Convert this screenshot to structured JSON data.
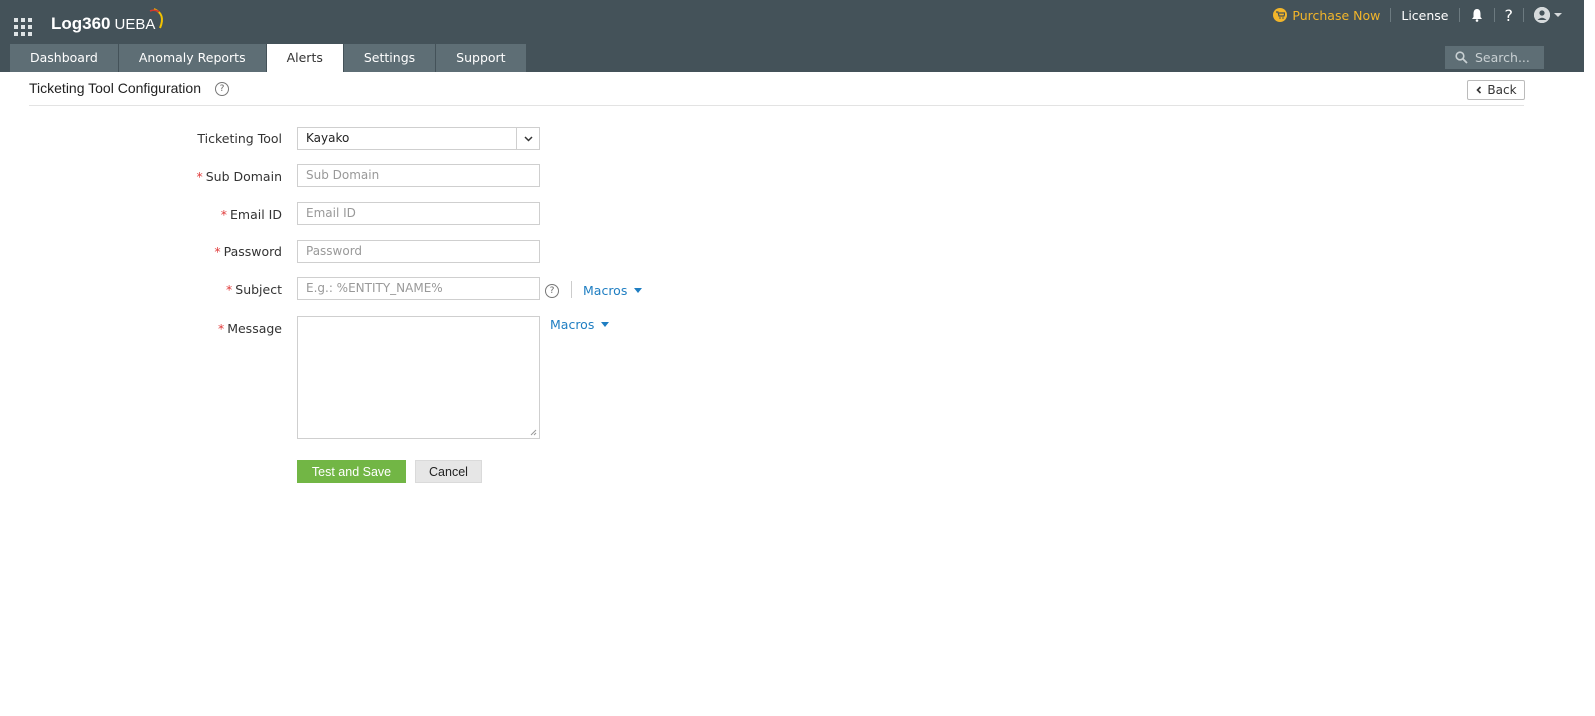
{
  "header": {
    "brand_main": "Log360",
    "brand_sub": "UEBA",
    "purchase_label": "Purchase Now",
    "license_label": "License",
    "help_label": "?",
    "search_placeholder": "Search..."
  },
  "tabs": [
    {
      "label": "Dashboard"
    },
    {
      "label": "Anomaly Reports"
    },
    {
      "label": "Alerts",
      "active": true
    },
    {
      "label": "Settings"
    },
    {
      "label": "Support"
    }
  ],
  "page": {
    "title": "Ticketing Tool Configuration",
    "back_label": "Back"
  },
  "form": {
    "ticketing_tool": {
      "label": "Ticketing Tool",
      "value": "Kayako"
    },
    "sub_domain": {
      "label": "Sub Domain",
      "placeholder": "Sub Domain"
    },
    "email_id": {
      "label": "Email ID",
      "placeholder": "Email ID"
    },
    "password": {
      "label": "Password",
      "placeholder": "Password"
    },
    "subject": {
      "label": "Subject",
      "placeholder": "E.g.: %ENTITY_NAME%",
      "macros_label": "Macros"
    },
    "message": {
      "label": "Message",
      "macros_label": "Macros"
    },
    "required_mark": "*",
    "save_label": "Test and Save",
    "cancel_label": "Cancel"
  },
  "colors": {
    "header_bg": "#445259",
    "tab_bg": "#5e6e75",
    "accent_link": "#1f7ec2",
    "primary_button": "#72b645",
    "purchase": "#f2b52a",
    "required": "#e03b3b"
  }
}
